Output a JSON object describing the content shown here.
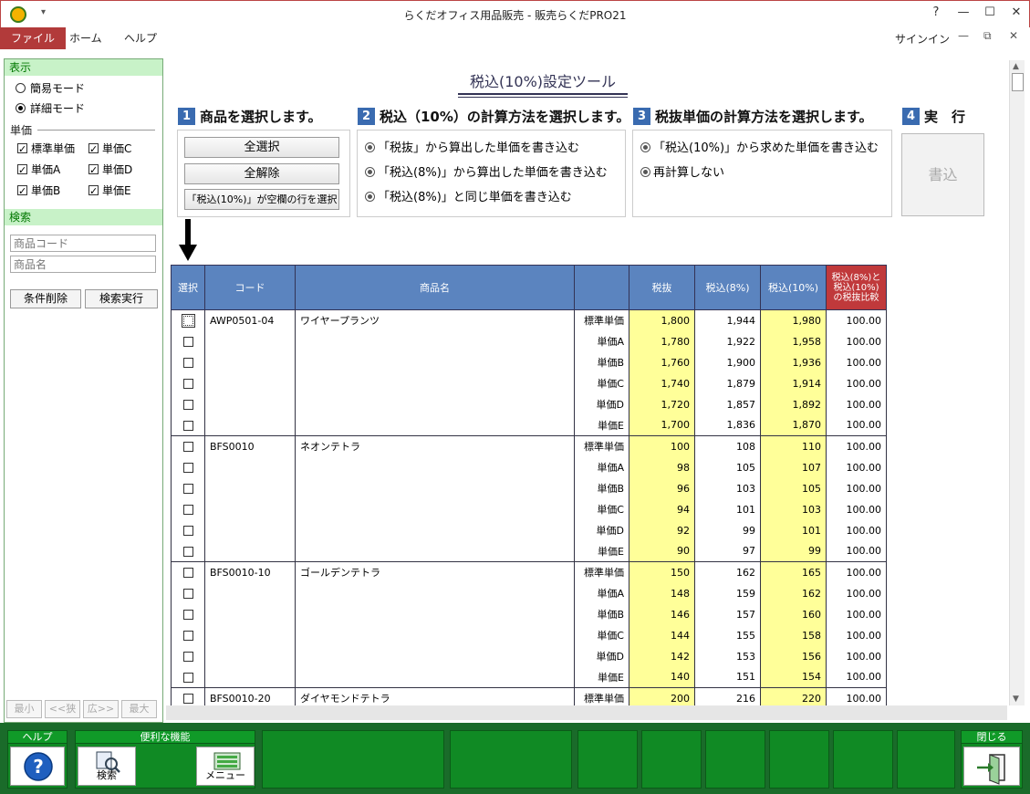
{
  "window": {
    "title": "らくだオフィス用品販売 - 販売らくだPRO21",
    "help_glyph": "?",
    "min_glyph": "—",
    "max_glyph": "☐",
    "close_glyph": "✕"
  },
  "menu": {
    "items": [
      "ファイル",
      "ホーム",
      "ヘルプ"
    ],
    "signin": "サインイン"
  },
  "left_panel": {
    "display_heading": "表示",
    "modes": [
      {
        "label": "簡易モード",
        "selected": false
      },
      {
        "label": "詳細モード",
        "selected": true
      }
    ],
    "tanka_heading": "単価",
    "price_checks": [
      "標準単価",
      "単価C",
      "単価A",
      "単価D",
      "単価B",
      "単価E"
    ],
    "search_heading": "検索",
    "search_code_placeholder": "商品コード",
    "search_name_placeholder": "商品名",
    "clear_button": "条件削除",
    "search_button": "検索実行",
    "pager": [
      "最小",
      "<<狭",
      "広>>",
      "最大"
    ]
  },
  "main": {
    "title": "税込(10%)設定ツール",
    "steps": [
      {
        "num": "1",
        "label": "商品を選択します。"
      },
      {
        "num": "2",
        "label": "税込（10%）の計算方法を選択します。"
      },
      {
        "num": "3",
        "label": "税抜単価の計算方法を選択します。"
      },
      {
        "num": "4",
        "label": "実　行"
      }
    ],
    "select_buttons": [
      "全選択",
      "全解除",
      "「税込(10%)」が空欄の行を選択"
    ],
    "calc_options": [
      "「税抜」から算出した単価を書き込む",
      "「税込(8%)」から算出した単価を書き込む",
      "「税込(8%)」と同じ単価を書き込む"
    ],
    "net_options": [
      "「税込(10%)」から求めた単価を書き込む",
      "再計算しない"
    ],
    "execute_button": "書込"
  },
  "table": {
    "headers": [
      "選択",
      "コード",
      "商品名",
      "",
      "税抜",
      "税込(8%)",
      "税込(10%)"
    ],
    "compare_header": [
      "税込(8%)と",
      "税込(10%)",
      "の税抜比較"
    ],
    "groups": [
      {
        "code": "AWP0501-04",
        "name": "ワイヤープランツ",
        "rows": [
          {
            "label": "標準単価",
            "net": "1,800",
            "tax8": "1,944",
            "tax10": "1,980",
            "ratio": "100.00"
          },
          {
            "label": "単価A",
            "net": "1,780",
            "tax8": "1,922",
            "tax10": "1,958",
            "ratio": "100.00"
          },
          {
            "label": "単価B",
            "net": "1,760",
            "tax8": "1,900",
            "tax10": "1,936",
            "ratio": "100.00"
          },
          {
            "label": "単価C",
            "net": "1,740",
            "tax8": "1,879",
            "tax10": "1,914",
            "ratio": "100.00"
          },
          {
            "label": "単価D",
            "net": "1,720",
            "tax8": "1,857",
            "tax10": "1,892",
            "ratio": "100.00"
          },
          {
            "label": "単価E",
            "net": "1,700",
            "tax8": "1,836",
            "tax10": "1,870",
            "ratio": "100.00"
          }
        ]
      },
      {
        "code": "BFS0010",
        "name": "ネオンテトラ",
        "rows": [
          {
            "label": "標準単価",
            "net": "100",
            "tax8": "108",
            "tax10": "110",
            "ratio": "100.00"
          },
          {
            "label": "単価A",
            "net": "98",
            "tax8": "105",
            "tax10": "107",
            "ratio": "100.00"
          },
          {
            "label": "単価B",
            "net": "96",
            "tax8": "103",
            "tax10": "105",
            "ratio": "100.00"
          },
          {
            "label": "単価C",
            "net": "94",
            "tax8": "101",
            "tax10": "103",
            "ratio": "100.00"
          },
          {
            "label": "単価D",
            "net": "92",
            "tax8": "99",
            "tax10": "101",
            "ratio": "100.00"
          },
          {
            "label": "単価E",
            "net": "90",
            "tax8": "97",
            "tax10": "99",
            "ratio": "100.00"
          }
        ]
      },
      {
        "code": "BFS0010-10",
        "name": "ゴールデンテトラ",
        "rows": [
          {
            "label": "標準単価",
            "net": "150",
            "tax8": "162",
            "tax10": "165",
            "ratio": "100.00"
          },
          {
            "label": "単価A",
            "net": "148",
            "tax8": "159",
            "tax10": "162",
            "ratio": "100.00"
          },
          {
            "label": "単価B",
            "net": "146",
            "tax8": "157",
            "tax10": "160",
            "ratio": "100.00"
          },
          {
            "label": "単価C",
            "net": "144",
            "tax8": "155",
            "tax10": "158",
            "ratio": "100.00"
          },
          {
            "label": "単価D",
            "net": "142",
            "tax8": "153",
            "tax10": "156",
            "ratio": "100.00"
          },
          {
            "label": "単価E",
            "net": "140",
            "tax8": "151",
            "tax10": "154",
            "ratio": "100.00"
          }
        ]
      },
      {
        "code": "BFS0010-20",
        "name": "ダイヤモンドテトラ",
        "rows": [
          {
            "label": "標準単価",
            "net": "200",
            "tax8": "216",
            "tax10": "220",
            "ratio": "100.00"
          }
        ]
      }
    ]
  },
  "footer": {
    "help_label": "ヘルプ",
    "functions_label": "便利な機能",
    "search_btn": "検索",
    "menu_btn": "メニュー",
    "close_label": "閉じる"
  },
  "colors": {
    "accent_red": "#b23a3a",
    "table_header": "#5b84bf",
    "highlight_yellow": "#ffff99",
    "footer_green": "#108a24"
  }
}
